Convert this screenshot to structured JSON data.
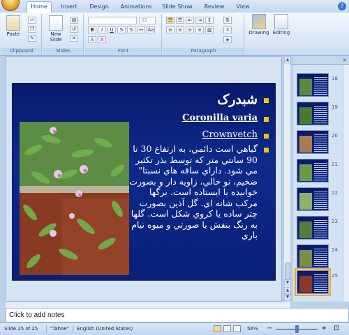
{
  "ribbon": {
    "tabs": [
      "Home",
      "Insert",
      "Design",
      "Animations",
      "Slide Show",
      "Review",
      "View"
    ],
    "active_tab": "Home",
    "groups": {
      "clipboard": "Clipboard",
      "slides": "Slides",
      "font": "Font",
      "paragraph": "Paragraph"
    },
    "paste_label": "Paste",
    "new_slide_label": "New Slide",
    "drawing_label": "Drawing",
    "editing_label": "Editing",
    "font_size": "32"
  },
  "slide": {
    "title": "شبدرک",
    "scientific_name": "Coronilla varia",
    "common_name": "Crownvetch",
    "description": "گياهي است دائمي، به ارتفاع 30 تا 90 سانتي متر كه توسط بذر تكثير مي شود. داراي ساقه هاي نسبتا\" ضخيم، نو خالي، زاويه دار و بصورت خوابيده يا ايستاده است. برگها مركب شانه اي. گل آذين بصورت چتر ساده يا كروي شكل است. گلها به رنگ بنفش يا صورتي و ميوه نيام باري"
  },
  "slides_pane": {
    "thumbnails": [
      {
        "number": "18"
      },
      {
        "number": "19"
      },
      {
        "number": "20"
      },
      {
        "number": "21"
      },
      {
        "number": "22"
      },
      {
        "number": "23"
      },
      {
        "number": "24"
      },
      {
        "number": "25",
        "selected": true
      }
    ]
  },
  "notes": {
    "placeholder": "Click to add notes"
  },
  "status_bar": {
    "slide_position": "Slide 25 of 25",
    "theme": "\"Tahoe\"",
    "language": "English (United States)",
    "zoom": "56%"
  },
  "colors": {
    "slide_background": "#0c2a8c",
    "bullet": "#f1c400",
    "selected_thumb": "#f5a623"
  }
}
